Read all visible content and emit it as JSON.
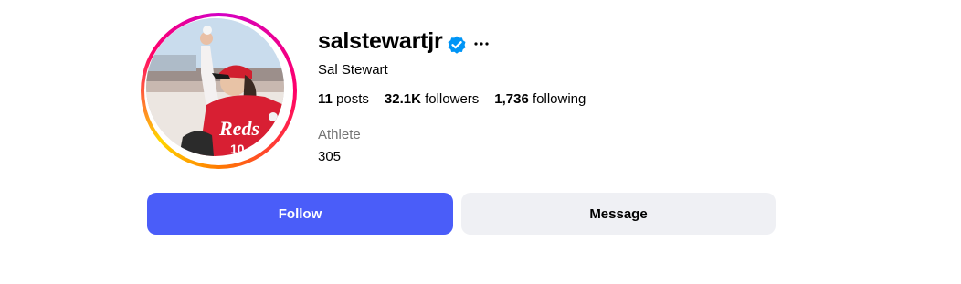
{
  "profile": {
    "username": "salstewartjr",
    "full_name": "Sal Stewart",
    "verified": true,
    "category": "Athlete",
    "bio": "305",
    "avatar_icon": "athlete-profile-photo"
  },
  "stats": {
    "posts_count": "11",
    "posts_label": "posts",
    "followers_count": "32.1K",
    "followers_label": "followers",
    "following_count": "1,736",
    "following_label": "following"
  },
  "actions": {
    "follow_label": "Follow",
    "message_label": "Message"
  },
  "colors": {
    "accent": "#4a5df9",
    "verified": "#0095f6",
    "secondary_button": "#eff0f4",
    "muted_text": "#737373"
  }
}
